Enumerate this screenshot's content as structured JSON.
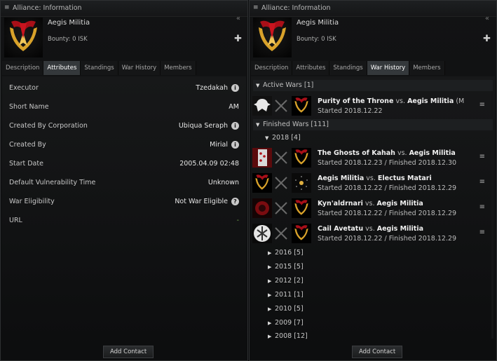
{
  "left": {
    "title": "Alliance: Information",
    "name": "Aegis Militia",
    "bounty": "Bounty: 0 ISK",
    "tabs": [
      "Description",
      "Attributes",
      "Standings",
      "War History",
      "Members"
    ],
    "active_tab": "Attributes",
    "attributes": [
      {
        "label": "Executor",
        "value": "Tzedakah",
        "info": true
      },
      {
        "label": "Short Name",
        "value": "AM",
        "info": false
      },
      {
        "label": "Created By Corporation",
        "value": "Ubiqua Seraph",
        "info": true
      },
      {
        "label": "Created By",
        "value": "Mirial",
        "info": true
      },
      {
        "label": "Start Date",
        "value": "2005.04.09 02:48",
        "info": false
      },
      {
        "label": "Default Vulnerability Time",
        "value": "Unknown",
        "info": false
      },
      {
        "label": "War Eligibility",
        "value": "Not War Eligible",
        "info": "?"
      },
      {
        "label": "URL",
        "value": "-",
        "info": false
      }
    ],
    "button": "Add Contact"
  },
  "right": {
    "title": "Alliance: Information",
    "name": "Aegis Militia",
    "bounty": "Bounty: 0 ISK",
    "tabs": [
      "Description",
      "Attributes",
      "Standings",
      "War History",
      "Members"
    ],
    "active_tab": "War History",
    "active_header": "Active Wars [1]",
    "active_wars": [
      {
        "attacker": "Purity of the Throne",
        "vs": "vs.",
        "defender": "Aegis Militia",
        "suffix": "(M",
        "dates": "Started 2018.12.22"
      }
    ],
    "finished_header": "Finished Wars [111]",
    "year_2018": "2018 [4]",
    "finished_wars": [
      {
        "attacker": "The Ghosts of Kahah",
        "vs": "vs.",
        "defender": "Aegis Militia",
        "suffix": "",
        "dates": "Started 2018.12.23 / Finished 2018.12.30"
      },
      {
        "attacker": "Aegis Militia",
        "vs": "vs.",
        "defender": "Electus Matari",
        "suffix": "",
        "dates": "Started 2018.12.22 / Finished 2018.12.29"
      },
      {
        "attacker": "Kyn'aldrnari",
        "vs": "vs.",
        "defender": "Aegis Militia",
        "suffix": "",
        "dates": "Started 2018.12.22 / Finished 2018.12.29"
      },
      {
        "attacker": "Cail Avetatu",
        "vs": "vs.",
        "defender": "Aegis Militia",
        "suffix": "",
        "dates": "Started 2018.12.22 / Finished 2018.12.29"
      }
    ],
    "years": [
      "2016 [5]",
      "2015 [5]",
      "2012 [2]",
      "2011 [1]",
      "2010 [5]",
      "2009 [7]",
      "2008 [12]"
    ],
    "button": "Add Contact"
  },
  "icons": {
    "menu": "hamburger-menu-icon",
    "collapse": "double-chevron-icon",
    "add": "plus-icon",
    "info": "info-icon",
    "swords": "crossed-swords-icon"
  },
  "colors": {
    "active_tab_bg": "#34383b",
    "alliance_logo_red": "#b5121b",
    "alliance_logo_gold": "#d9a22a"
  }
}
